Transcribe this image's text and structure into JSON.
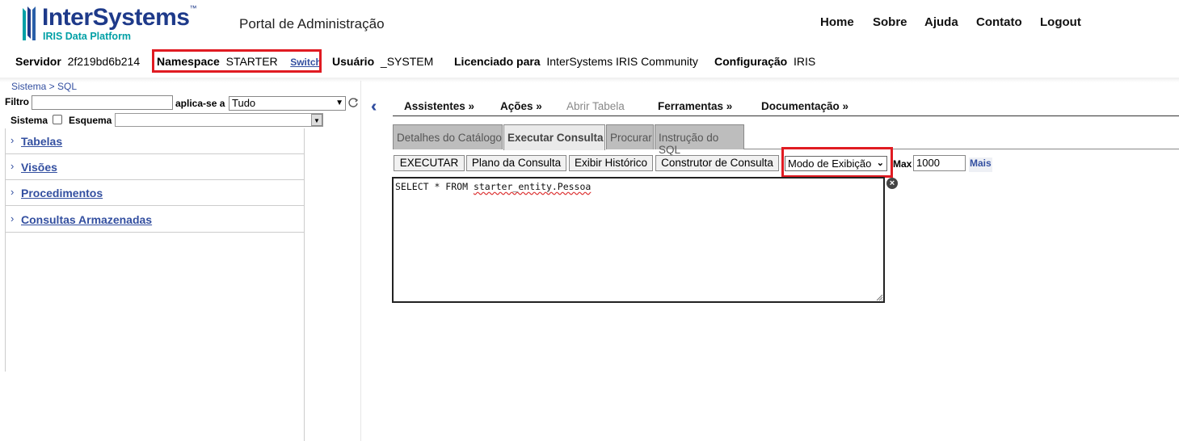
{
  "header": {
    "logo_text": "InterSystems",
    "logo_tm": "™",
    "logo_tagline": "IRIS Data Platform",
    "portal_title": "Portal de Administração",
    "nav": [
      "Home",
      "Sobre",
      "Ajuda",
      "Contato",
      "Logout"
    ]
  },
  "infobar": {
    "server_label": "Servidor",
    "server_value": "2f219bd6b214",
    "namespace_label": "Namespace",
    "namespace_value": "STARTER",
    "switch_label": "Switch",
    "user_label": "Usuário",
    "user_value": "_SYSTEM",
    "licensed_label": "Licenciado para",
    "licensed_value": "InterSystems IRIS Community",
    "config_label": "Configuração",
    "config_value": "IRIS"
  },
  "breadcrumb": "Sistema > SQL",
  "left_panel": {
    "filter_label": "Filtro",
    "filter_value": "",
    "applies_label": "aplica-se a",
    "applies_value": "Tudo",
    "system_label": "Sistema",
    "schema_label": "Esquema",
    "schema_value": "",
    "tree_items": [
      "Tabelas",
      "Visões",
      "Procedimentos",
      "Consultas Armazenadas"
    ]
  },
  "menu": {
    "items": [
      "Assistentes »",
      "Ações »",
      "Abrir Tabela",
      "Ferramentas »",
      "Documentação »"
    ]
  },
  "tabs": [
    "Detalhes do Catálogo",
    "Executar Consulta",
    "Procurar",
    "Instrução do SQL"
  ],
  "active_tab": "Executar Consulta",
  "toolbar": {
    "execute_label": "EXECUTAR",
    "plan_label": "Plano da Consulta",
    "history_label": "Exibir Histórico",
    "builder_label": "Construtor de Consulta",
    "display_mode_value": "Modo de Exibição",
    "max_label": "Max",
    "max_value": "1000",
    "more_label": "Mais"
  },
  "query": {
    "prefix": "SELECT * FROM ",
    "table": "starter_entity.Pessoa"
  },
  "colors": {
    "brand_blue": "#1e3a8a",
    "brand_teal": "#00a0a6",
    "link_blue": "#334fa0",
    "highlight_red": "#e01b22"
  }
}
